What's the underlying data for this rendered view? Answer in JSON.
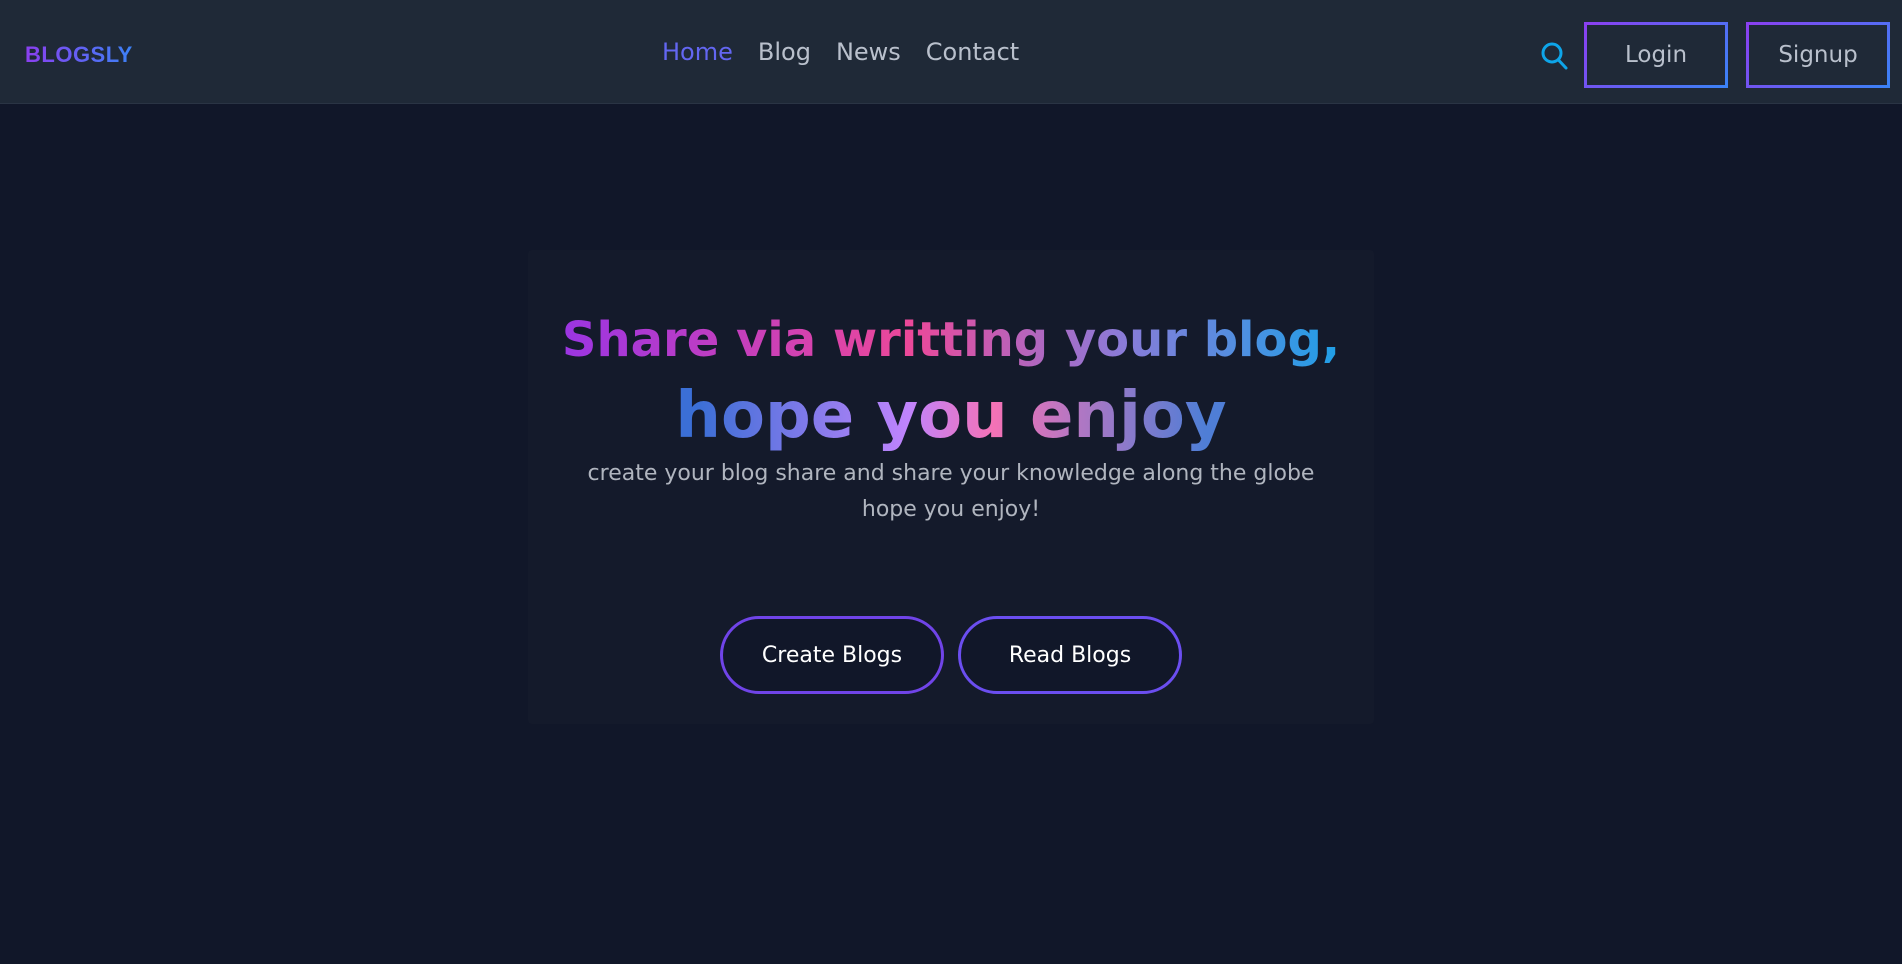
{
  "navbar": {
    "brand": "BLOGSLY",
    "links": [
      {
        "label": "Home",
        "active": true
      },
      {
        "label": "Blog",
        "active": false
      },
      {
        "label": "News",
        "active": false
      },
      {
        "label": "Contact",
        "active": false
      }
    ],
    "search_icon": "search-icon",
    "login_label": "Login",
    "signup_label": "Signup"
  },
  "hero": {
    "headline_line1": "Share via writting your blog,",
    "headline_line2": "hope you enjoy",
    "description": "create your blog share and share your knowledge along the globe hope you enjoy!",
    "create_button": "Create Blogs",
    "read_button": "Read Blogs"
  },
  "colors": {
    "background": "#111729",
    "navbar": "#1f2937",
    "accent": "#6366f1",
    "gradient_start": "#8b3ff0",
    "gradient_end": "#3b82f6"
  }
}
